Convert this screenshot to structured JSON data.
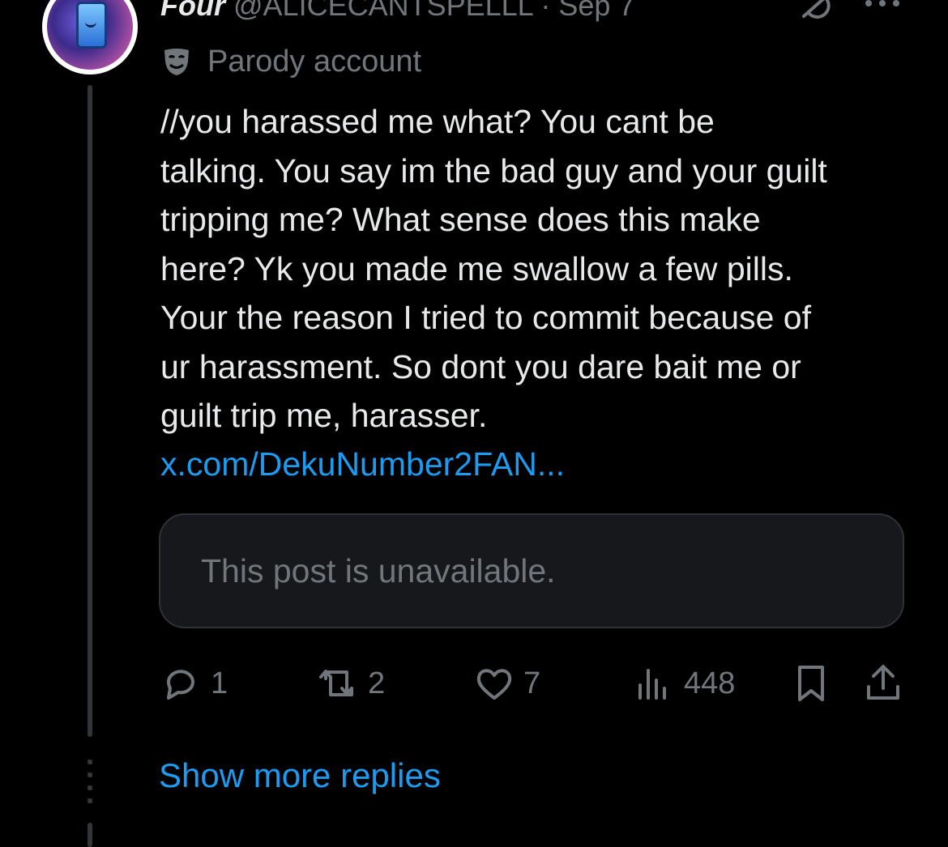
{
  "author": {
    "name": "Four",
    "handle": "@ALICECANTSPELLL",
    "separator": "·",
    "date": "Sep 7",
    "label": "Parody account"
  },
  "post": {
    "text": "//you harassed me what? You cant be\ntalking. You say im the bad guy and your guilt\ntripping me? What sense does this make\nhere? Yk you made me swallow a few pills.\nYour the reason I tried to commit because of\nur harassment. So dont you dare bait me or\nguilt trip me, harasser.",
    "link": "x.com/DekuNumber2FAN..."
  },
  "quoted": {
    "message": "This post is unavailable."
  },
  "actions": {
    "replies": "1",
    "reposts": "2",
    "likes": "7",
    "views": "448"
  },
  "show_more": "Show more replies",
  "colors": {
    "background": "#000000",
    "text": "#e7e9ea",
    "muted": "#71767b",
    "link": "#1d9bf0"
  }
}
